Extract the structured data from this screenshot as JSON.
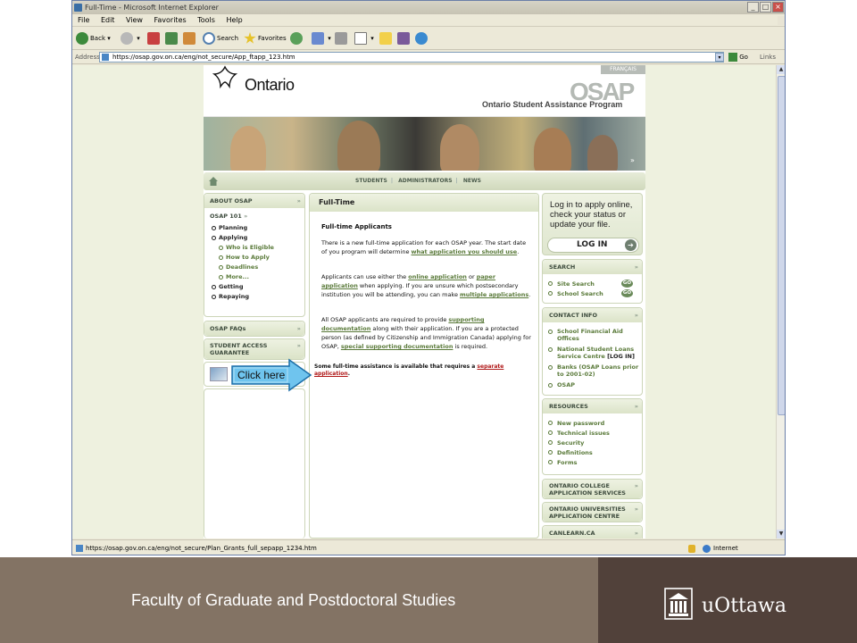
{
  "browser": {
    "title": "Full-Time - Microsoft Internet Explorer",
    "menu": [
      "File",
      "Edit",
      "View",
      "Favorites",
      "Tools",
      "Help"
    ],
    "toolbar": {
      "back": "Back",
      "search": "Search",
      "favorites": "Favorites"
    },
    "address_label": "Address",
    "url": "https://osap.gov.on.ca/eng/not_secure/App_ftapp_123.htm",
    "go": "Go",
    "links": "Links",
    "status_url": "https://osap.gov.on.ca/eng/not_secure/Plan_Grants_full_sepapp_1234.htm",
    "zone": "Internet"
  },
  "page": {
    "ontario": "Ontario",
    "francais": "FRANÇAIS",
    "osap_logo": "OSAP",
    "program": "Ontario Student Assistance Program",
    "topnav": [
      "STUDENTS",
      "ADMINISTRATORS",
      "NEWS"
    ],
    "left": {
      "about": "ABOUT OSAP",
      "osap101": "OSAP 101",
      "items": {
        "planning": "Planning",
        "applying": "Applying",
        "who": "Who is Eligible",
        "how": "How to Apply",
        "deadlines": "Deadlines",
        "more": "More...",
        "getting": "Getting",
        "repaying": "Repaying"
      },
      "faqs": "OSAP FAQs",
      "guarantee1": "STUDENT ACCESS",
      "guarantee2": "GUARANTEE"
    },
    "content": {
      "header": "Full-Time",
      "heading": "Full-time Applicants",
      "p1a": "There is a new full-time application for each OSAP year. The start date of you program will determine ",
      "p1link": "what application you should use",
      "p2a": "Applicants can use either the ",
      "p2l1": "online application",
      "p2b": " or ",
      "p2l2": "paper application",
      "p2c": " when applying. If you are unsure which postsecondary institution you will be attending, you can make ",
      "p2l3": "multiple applications",
      "p3a": "All OSAP applicants are required to provide ",
      "p3l1": "supporting documentation",
      "p3b": " along with their application. If you are a protected person (as defined by Citizenship and Immigration Canada) applying for OSAP, ",
      "p3l2": "special supporting documentation",
      "p3c": " is required.",
      "p4a": "Some full-time assistance is available that requires a ",
      "p4l": "separate application"
    },
    "login": {
      "text": "Log in to apply online, check your status or update your file.",
      "button": "LOG IN"
    },
    "search": {
      "title": "SEARCH",
      "site": "Site Search",
      "school": "School Search",
      "go": "GO"
    },
    "contact": {
      "title": "CONTACT INFO",
      "items": [
        "School Financial Aid Offices",
        "National Student Loans Service Centre",
        "Banks (OSAP Loans prior to 2001-02)",
        "OSAP"
      ],
      "login_tag": "[LOG IN]"
    },
    "resources": {
      "title": "RESOURCES",
      "items": [
        "New password",
        "Technical issues",
        "Security",
        "Definitions",
        "Forms"
      ]
    },
    "ocas1": "ONTARIO COLLEGE",
    "ocas2": "APPLICATION SERVICES",
    "ouac1": "ONTARIO UNIVERSITIES",
    "ouac2": "APPLICATION CENTRE",
    "canlearn": "CANLEARN.CA"
  },
  "callout": "Click here",
  "slide": {
    "faculty": "Faculty of Graduate and Postdoctoral Studies",
    "university": "uOttawa"
  }
}
